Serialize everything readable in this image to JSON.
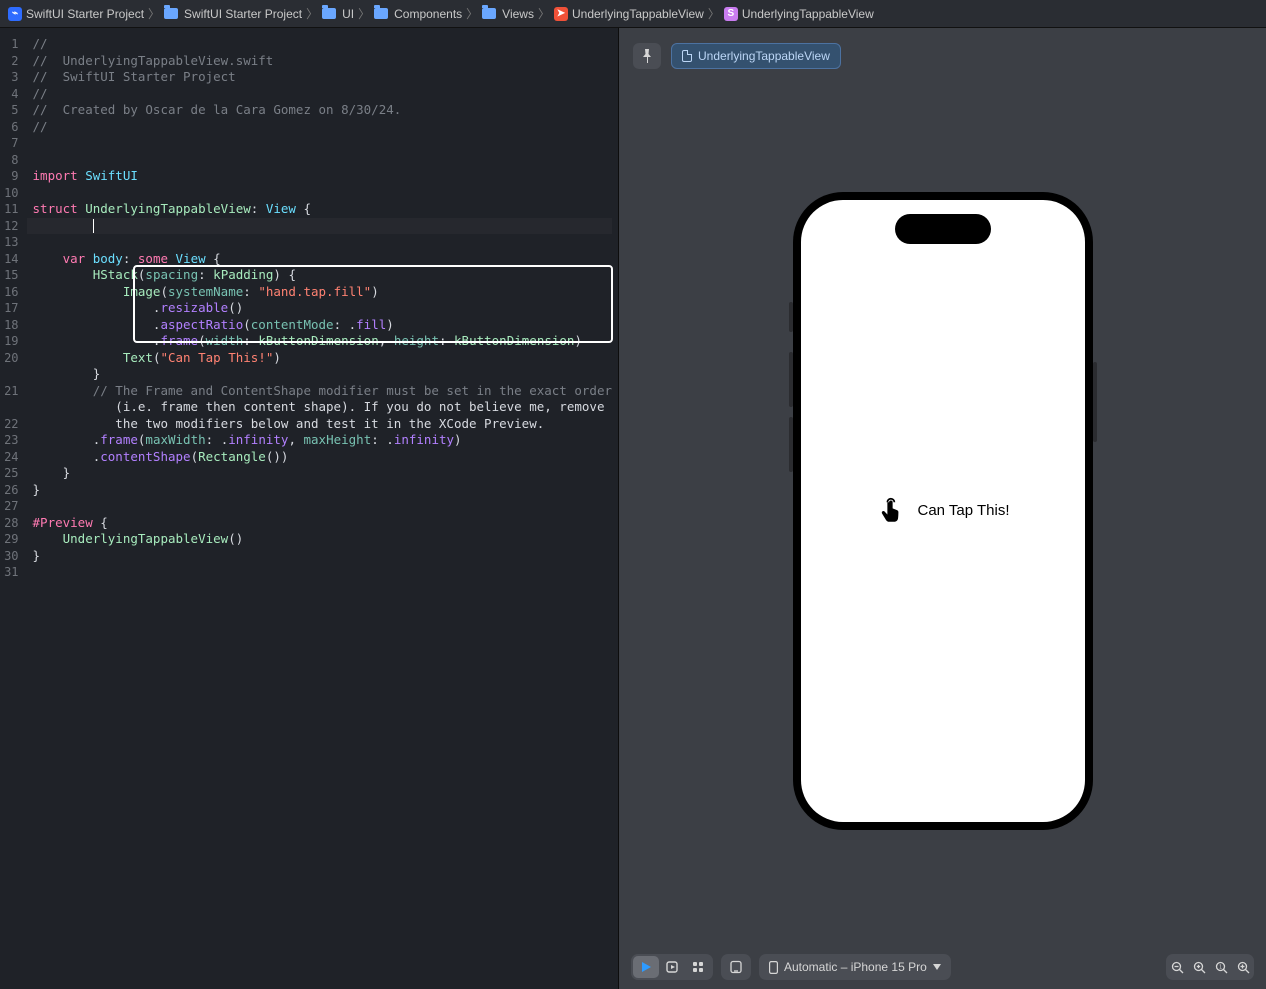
{
  "breadcrumbs": [
    {
      "label": "SwiftUI Starter Project",
      "icon": "app"
    },
    {
      "label": "SwiftUI Starter Project",
      "icon": "folder"
    },
    {
      "label": "UI",
      "icon": "folder"
    },
    {
      "label": "Components",
      "icon": "folder"
    },
    {
      "label": "Views",
      "icon": "folder"
    },
    {
      "label": "UnderlyingTappableView",
      "icon": "swift"
    },
    {
      "label": "UnderlyingTappableView",
      "icon": "struct"
    }
  ],
  "code": {
    "lines": [
      "//",
      "//  UnderlyingTappableView.swift",
      "//  SwiftUI Starter Project",
      "//",
      "//  Created by Oscar de la Cara Gomez on 8/30/24.",
      "//",
      "",
      "",
      "import SwiftUI",
      "",
      "struct UnderlyingTappableView: View {",
      "",
      "    var body: some View {",
      "        HStack(spacing: kPadding) {",
      "            Image(systemName: \"hand.tap.fill\")",
      "                .resizable()",
      "                .aspectRatio(contentMode: .fill)",
      "                .frame(width: kButtonDimension, height: kButtonDimension)",
      "            Text(\"Can Tap This!\")",
      "        }",
      "        // The Frame and ContentShape modifier must be set in the exact order",
      "           (i.e. frame then content shape). If you do not believe me, remove",
      "           the two modifiers below and test it in the XCode Preview.",
      "        .frame(maxWidth: .infinity, maxHeight: .infinity)",
      "        .contentShape(Rectangle())",
      "    }",
      "}",
      "",
      "#Preview {",
      "    UnderlyingTappableView()",
      "}",
      "",
      ""
    ],
    "line_numbers": [
      "1",
      "2",
      "3",
      "4",
      "5",
      "6",
      "7",
      "8",
      "9",
      "10",
      "11",
      "12",
      "13",
      "14",
      "15",
      "16",
      "17",
      "18",
      "19",
      "20",
      "",
      "21",
      "",
      "22",
      "23",
      "24",
      "25",
      "26",
      "27",
      "28",
      "29",
      "30",
      "31"
    ]
  },
  "preview": {
    "chip_label": "UnderlyingTappableView",
    "screen_text": "Can Tap This!",
    "device_label": "Automatic – iPhone 15 Pro"
  }
}
